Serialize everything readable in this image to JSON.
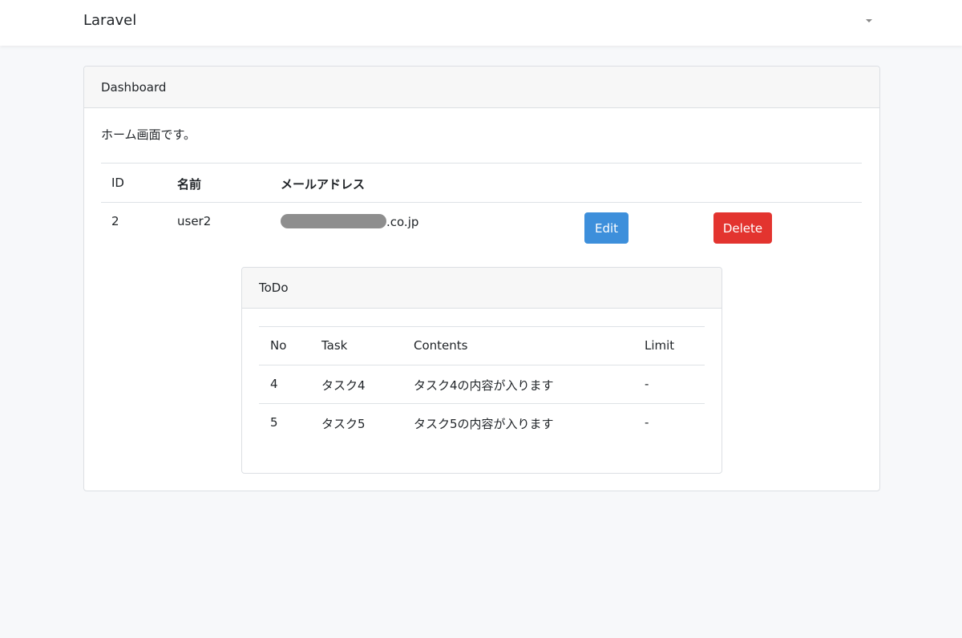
{
  "navbar": {
    "brand": "Laravel"
  },
  "dashboard": {
    "header": "Dashboard",
    "intro": "ホーム画面です。",
    "columns": [
      "ID",
      "名前",
      "メールアドレス"
    ],
    "users": [
      {
        "id": "2",
        "name": "user2",
        "email_visible_suffix": ".co.jp",
        "edit_label": "Edit",
        "delete_label": "Delete"
      }
    ]
  },
  "todo": {
    "header": "ToDo",
    "columns": [
      "No",
      "Task",
      "Contents",
      "Limit"
    ],
    "rows": [
      {
        "no": "4",
        "task": "タスク4",
        "contents": "タスク4の内容が入ります",
        "limit": "-"
      },
      {
        "no": "5",
        "task": "タスク5",
        "contents": "タスク5の内容が入ります",
        "limit": "-"
      }
    ]
  },
  "colors": {
    "edit_button": "#3d8fdb",
    "delete_button": "#e3342f",
    "page_background": "#f7f8fa"
  }
}
